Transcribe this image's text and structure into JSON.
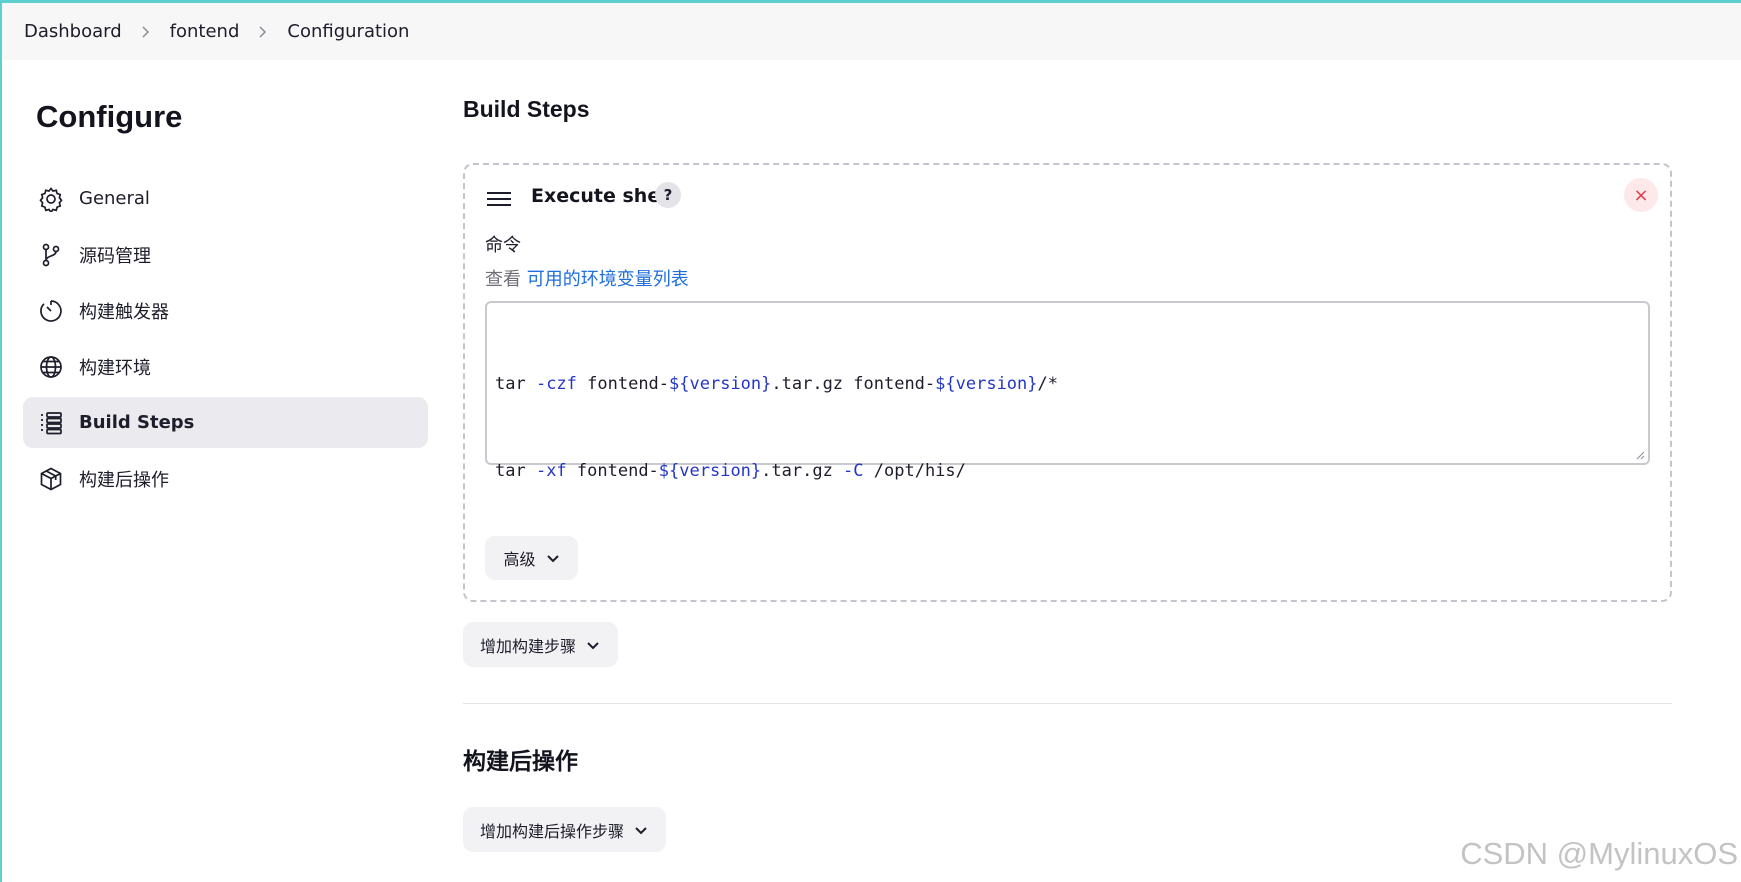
{
  "breadcrumb": {
    "items": [
      "Dashboard",
      "fontend",
      "Configuration"
    ]
  },
  "sidebar": {
    "title": "Configure",
    "items": [
      {
        "label": "General",
        "icon": "gear-icon",
        "active": false
      },
      {
        "label": "源码管理",
        "icon": "branch-icon",
        "active": false
      },
      {
        "label": "构建触发器",
        "icon": "timer-icon",
        "active": false
      },
      {
        "label": "构建环境",
        "icon": "globe-icon",
        "active": false
      },
      {
        "label": "Build Steps",
        "icon": "list-icon",
        "active": true
      },
      {
        "label": "构建后操作",
        "icon": "package-icon",
        "active": false
      }
    ]
  },
  "main": {
    "build_steps_title": "Build Steps",
    "step": {
      "title": "Execute shell",
      "help": "?",
      "close": "×",
      "field_label": "命令",
      "env_hint_prefix": "查看",
      "env_hint_link": "可用的环境变量列表",
      "command_lines": [
        "tar -czf fontend-${version}.tar.gz fontend-${version}/*",
        "tar -xf fontend-${version}.tar.gz -C /opt/his/"
      ],
      "advanced_label": "高级"
    },
    "add_step_label": "增加构建步骤",
    "post_build_title": "构建后操作",
    "add_post_step_label": "增加构建后操作步骤"
  },
  "watermark": "CSDN @MylinuxOS",
  "colors": {
    "accent_link": "#1f6fdc",
    "close_red": "#e5394b",
    "active_bg": "#ebebef",
    "window_border": "#5ecfcf"
  }
}
